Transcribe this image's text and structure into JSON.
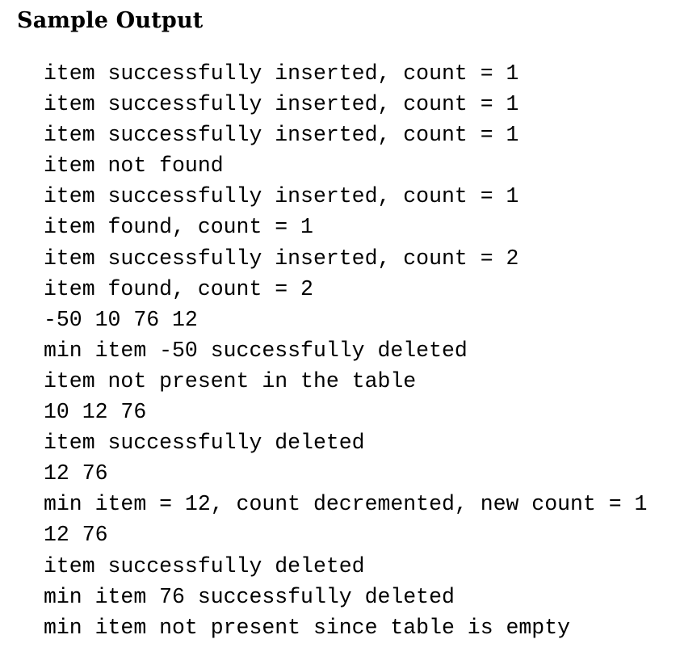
{
  "title": "Sample Output",
  "lines": [
    "item successfully inserted, count = 1",
    "item successfully inserted, count = 1",
    "item successfully inserted, count = 1",
    "item not found",
    "item successfully inserted, count = 1",
    "item found, count = 1",
    "item successfully inserted, count = 2",
    "item found, count = 2",
    "-50 10 76 12",
    "min item -50 successfully deleted",
    "item not present in the table",
    "10 12 76",
    "item successfully deleted",
    "12 76",
    "min item = 12, count decremented, new count = 1",
    "12 76",
    "item successfully deleted",
    "min item 76 successfully deleted",
    "min item not present since table is empty"
  ]
}
